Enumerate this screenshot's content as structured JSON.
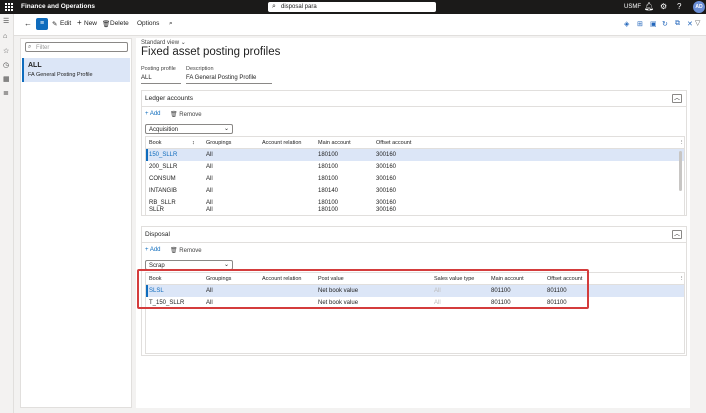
{
  "topbar": {
    "app_title": "Finance and Operations",
    "search_value": "disposal para",
    "company": "USMF",
    "avatar": "AD"
  },
  "actions": {
    "edit": "Edit",
    "new": "New",
    "delete": "Delete",
    "options": "Options"
  },
  "list": {
    "filter_placeholder": "Filter",
    "selected_title": "ALL",
    "selected_sub": "FA General Posting Profile"
  },
  "page": {
    "view": "Standard view",
    "title": "Fixed asset posting profiles",
    "posting_profile_label": "Posting profile",
    "posting_profile_value": "ALL",
    "description_label": "Description",
    "description_value": "FA General Posting Profile"
  },
  "ledger": {
    "title": "Ledger accounts",
    "add": "Add",
    "remove": "Remove",
    "dropdown": "Acquisition",
    "columns": [
      "Book",
      "Groupings",
      "Account relation",
      "Main account",
      "Offset account"
    ],
    "rows": [
      [
        "150_SLLR",
        "All",
        "",
        "180100",
        "300160"
      ],
      [
        "200_SLLR",
        "All",
        "",
        "180100",
        "300160"
      ],
      [
        "CONSUM",
        "All",
        "",
        "180100",
        "300160"
      ],
      [
        "INTANGIB",
        "All",
        "",
        "180140",
        "300160"
      ],
      [
        "RB_SLLR",
        "All",
        "",
        "180100",
        "300160"
      ],
      [
        "SLLR",
        "All",
        "",
        "180100",
        "300160"
      ]
    ]
  },
  "disposal": {
    "title": "Disposal",
    "add": "Add",
    "remove": "Remove",
    "dropdown": "Scrap",
    "columns": [
      "Book",
      "Groupings",
      "Account relation",
      "Post value",
      "Sales value type",
      "Main account",
      "Offset account"
    ],
    "rows": [
      [
        "SLSL",
        "All",
        "",
        "Net book value",
        "All",
        "801100",
        "801100"
      ],
      [
        "T_150_SLLR",
        "All",
        "",
        "Net book value",
        "All",
        "801100",
        "801100"
      ]
    ]
  }
}
